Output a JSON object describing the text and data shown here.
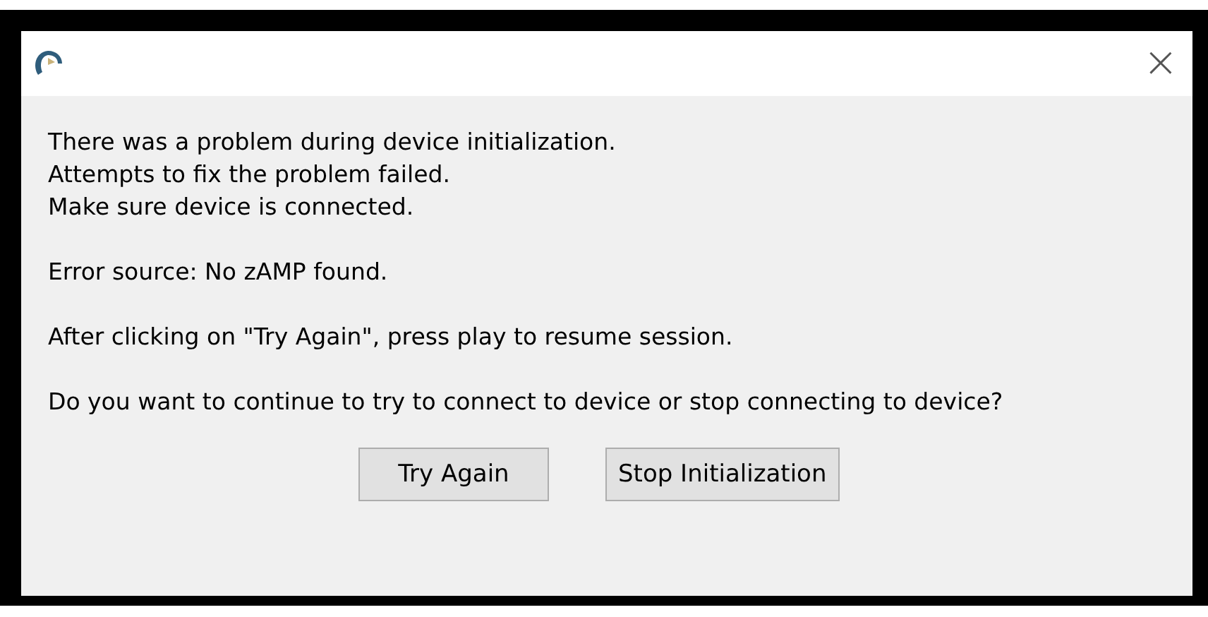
{
  "dialog": {
    "close": "×",
    "paragraphs": [
      [
        "There was a problem during device initialization.",
        "Attempts to fix the problem failed.",
        "Make sure device is connected."
      ],
      [
        "Error source: No zAMP found."
      ],
      [
        "After clicking on \"Try Again\", press play to resume session."
      ],
      [
        "Do you want to continue to try to connect to device or stop connecting to device?"
      ]
    ],
    "buttons": [
      "Try Again",
      "Stop Initialization"
    ]
  }
}
